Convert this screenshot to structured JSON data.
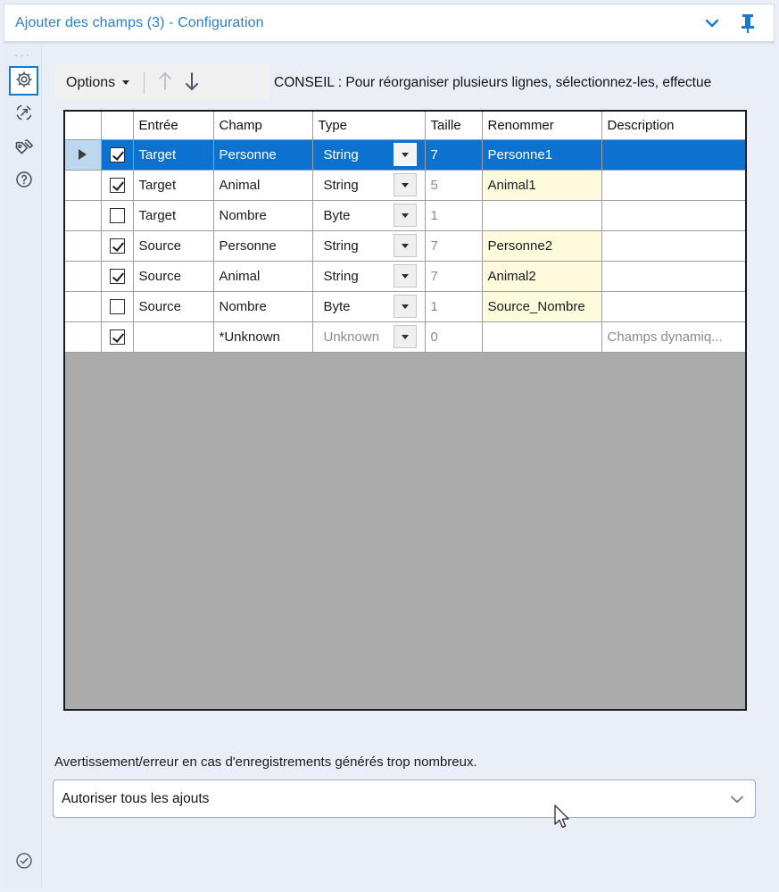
{
  "window": {
    "title": "Ajouter des champs (3) - Configuration",
    "collapse_icon": "chevron-down-icon",
    "pin_icon": "pin-icon"
  },
  "left_rail": {
    "handle": "···",
    "items": [
      {
        "icon": "gear-icon",
        "name": "configuration",
        "selected": true
      },
      {
        "icon": "refresh-arrow-icon",
        "name": "annotation",
        "selected": false
      },
      {
        "icon": "tag-icon",
        "name": "label",
        "selected": false
      },
      {
        "icon": "help-question-icon",
        "name": "help",
        "selected": false
      }
    ],
    "bottom_item": {
      "icon": "check-circle-icon",
      "name": "status-ok"
    }
  },
  "toolbar": {
    "options_label": "Options",
    "options_caret": "caret-down-icon",
    "move_up_icon": "arrow-up-icon",
    "move_up_enabled": false,
    "move_down_icon": "arrow-down-icon",
    "move_down_enabled": true,
    "tip_text": "CONSEIL : Pour réorganiser plusieurs lignes, sélectionnez-les, effectue"
  },
  "grid": {
    "headers": [
      "",
      "",
      "Entrée",
      "Champ",
      "Type",
      "Taille",
      "Renommer",
      "Description"
    ],
    "rows": [
      {
        "selected": true,
        "checked": true,
        "entree": "Target",
        "champ": "Personne",
        "type": "String",
        "type_muted": false,
        "taille": "7",
        "renommer": "Personne1",
        "renommer_highlight": false,
        "description": "",
        "description_muted": false
      },
      {
        "selected": false,
        "checked": true,
        "entree": "Target",
        "champ": "Animal",
        "type": "String",
        "type_muted": false,
        "taille": "5",
        "renommer": "Animal1",
        "renommer_highlight": true,
        "description": "",
        "description_muted": false
      },
      {
        "selected": false,
        "checked": false,
        "entree": "Target",
        "champ": "Nombre",
        "type": "Byte",
        "type_muted": false,
        "taille": "1",
        "renommer": "",
        "renommer_highlight": false,
        "description": "",
        "description_muted": false
      },
      {
        "selected": false,
        "checked": true,
        "entree": "Source",
        "champ": "Personne",
        "type": "String",
        "type_muted": false,
        "taille": "7",
        "renommer": "Personne2",
        "renommer_highlight": true,
        "description": "",
        "description_muted": false
      },
      {
        "selected": false,
        "checked": true,
        "entree": "Source",
        "champ": "Animal",
        "type": "String",
        "type_muted": false,
        "taille": "7",
        "renommer": "Animal2",
        "renommer_highlight": true,
        "description": "",
        "description_muted": false
      },
      {
        "selected": false,
        "checked": false,
        "entree": "Source",
        "champ": "Nombre",
        "type": "Byte",
        "type_muted": false,
        "taille": "1",
        "renommer": "Source_Nombre",
        "renommer_highlight": true,
        "description": "",
        "description_muted": false
      },
      {
        "selected": false,
        "checked": true,
        "entree": "",
        "champ": "*Unknown",
        "type": "Unknown",
        "type_muted": true,
        "taille": "0",
        "renommer": "",
        "renommer_highlight": false,
        "description": "Champs dynamiq...",
        "description_muted": true
      }
    ]
  },
  "footer": {
    "warning_label": "Avertissement/erreur en cas d'enregistrements générés trop nombreux.",
    "select_value": "Autoriser tous les ajouts",
    "select_caret": "chevron-down-icon"
  },
  "colors": {
    "accent": "#1779d0",
    "selection": "#0d72cf",
    "title_text": "#2a7fc9",
    "highlight_yellow": "#fdfbdc",
    "panel_background": "#eaeff7",
    "grid_empty": "#ababab"
  }
}
